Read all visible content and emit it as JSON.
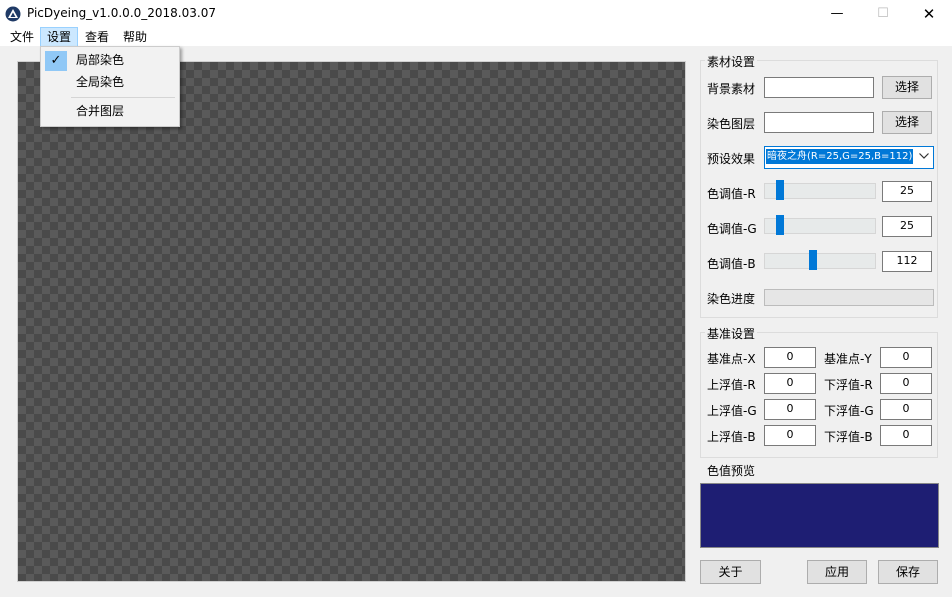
{
  "window": {
    "title": "PicDyeing_v1.0.0.0_2018.03.07",
    "minimize_glyph": "—",
    "maximize_glyph": "☐",
    "close_glyph": "✕"
  },
  "menu": {
    "items": [
      "文件",
      "设置",
      "查看",
      "帮助"
    ],
    "active_index": 1,
    "dropdown": {
      "items": [
        {
          "label": "局部染色",
          "checked": true
        },
        {
          "label": "全局染色",
          "checked": false
        },
        {
          "label": "合并图层",
          "checked": false
        }
      ]
    }
  },
  "material": {
    "group_title": "素材设置",
    "background_label": "背景素材",
    "background_value": "",
    "background_button": "选择",
    "dye_layer_label": "染色图层",
    "dye_layer_value": "",
    "dye_layer_button": "选择",
    "preset_label": "预设效果",
    "preset_value": "暗夜之舟(R=25,G=25,B=112)",
    "hue_r_label": "色调值-R",
    "hue_r_value": "25",
    "hue_g_label": "色调值-G",
    "hue_g_value": "25",
    "hue_b_label": "色调值-B",
    "hue_b_value": "112",
    "slider_r_fraction": 0.098,
    "slider_g_fraction": 0.098,
    "slider_b_fraction": 0.439,
    "progress_label": "染色进度",
    "progress_fraction": 0
  },
  "base": {
    "group_title": "基准设置",
    "point_x_label": "基准点-X",
    "point_x_value": "0",
    "point_y_label": "基准点-Y",
    "point_y_value": "0",
    "up_r_label": "上浮值-R",
    "up_r_value": "0",
    "down_r_label": "下浮值-R",
    "down_r_value": "0",
    "up_g_label": "上浮值-G",
    "up_g_value": "0",
    "down_g_label": "下浮值-G",
    "down_g_value": "0",
    "up_b_label": "上浮值-B",
    "up_b_value": "0",
    "down_b_label": "下浮值-B",
    "down_b_value": "0"
  },
  "preview": {
    "label": "色值预览",
    "color": "#1e1e73"
  },
  "buttons": {
    "about": "关于",
    "apply": "应用",
    "save": "保存"
  },
  "colors": {
    "accent": "#0078d7",
    "menu_highlight": "#cce8ff"
  }
}
